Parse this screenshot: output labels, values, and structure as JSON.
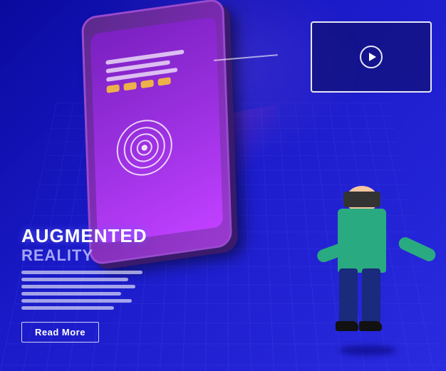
{
  "scene": {
    "background_color": "#1a1ab8"
  },
  "title": {
    "line1": "AUGMENTED",
    "line2": "REALITY"
  },
  "description_lines": [
    "",
    "",
    "",
    "",
    "",
    ""
  ],
  "buttons": {
    "read_more": "Read More"
  },
  "icons": {
    "play": "▶",
    "target": "◎"
  }
}
